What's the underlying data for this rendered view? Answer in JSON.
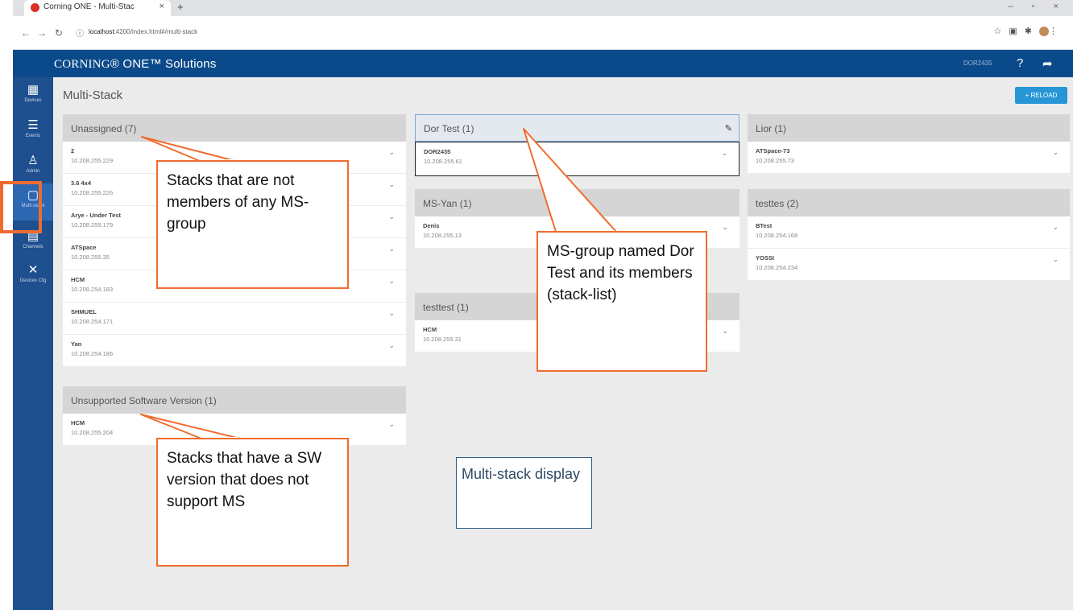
{
  "browser": {
    "tab_title": "Corning ONE - Multi-Stac",
    "tab_close": "×",
    "new_tab": "+",
    "url_host": "localhost",
    "url_rest": ":4200/index.html#/multi-stack",
    "window_controls": "– ▫ ×"
  },
  "header": {
    "brand_left": "CORNING",
    "brand_mid": "® ONE™ ",
    "brand_right": "Solutions",
    "user": "DOR2435"
  },
  "sidebar": {
    "items": [
      {
        "label": "Devices",
        "icon": "devices-icon"
      },
      {
        "label": "Events",
        "icon": "events-icon"
      },
      {
        "label": "Admin",
        "icon": "admin-icon"
      },
      {
        "label": "Multi-stack",
        "icon": "multi-stack-icon"
      },
      {
        "label": "Channels",
        "icon": "channels-icon"
      },
      {
        "label": "Devices Cfg",
        "icon": "tools-icon"
      }
    ]
  },
  "main": {
    "title": "Multi-Stack",
    "reload_label": "+ RELOAD"
  },
  "groups": {
    "unassigned": {
      "title": "Unassigned (7)",
      "cards": [
        {
          "name": "2",
          "ip": "10.208.255.229"
        },
        {
          "name": "3.6 4x4",
          "ip": "10.208.255.226"
        },
        {
          "name": "Arye - Under Test",
          "ip": "10.208.255.179"
        },
        {
          "name": "ATSpace",
          "ip": "10.208.255.35"
        },
        {
          "name": "HCM",
          "ip": "10.208.254.183"
        },
        {
          "name": "SHMUEL",
          "ip": "10.208.254.171"
        },
        {
          "name": "Yan",
          "ip": "10.208.254.186"
        }
      ]
    },
    "unsupported": {
      "title": "Unsupported Software Version (1)",
      "cards": [
        {
          "name": "HCM",
          "ip": "10.208.255.204"
        }
      ]
    },
    "dortest": {
      "title": "Dor Test (1)",
      "cards": [
        {
          "name": "DOR2435",
          "ip": "10.208.255.61"
        }
      ]
    },
    "msyan": {
      "title": "MS-Yan (1)",
      "cards": [
        {
          "name": "Denis",
          "ip": "10.208.255.13"
        }
      ]
    },
    "testtest": {
      "title": "testtest (1)",
      "cards": [
        {
          "name": "HCM",
          "ip": "10.208.255.31"
        }
      ]
    },
    "lior": {
      "title": "Lior (1)",
      "cards": [
        {
          "name": "ATSpace-73",
          "ip": "10.208.255.73"
        }
      ]
    },
    "testtes": {
      "title": "testtes (2)",
      "cards": [
        {
          "name": "BTest",
          "ip": "10.208.254.168"
        },
        {
          "name": "YOSSI",
          "ip": "10.208.254.234"
        }
      ]
    }
  },
  "callouts": {
    "unassigned": "Stacks that are not members of any MS-group",
    "unsupported": "Stacks that have a SW version that does not support MS",
    "group": "MS-group named Dor Test and its members (stack-list)",
    "display": "Multi-stack display"
  },
  "colors": {
    "accent": "#ef6c2f",
    "header": "#0b4a8a",
    "sidebar": "#1e4f8f",
    "reload": "#2696d6"
  }
}
